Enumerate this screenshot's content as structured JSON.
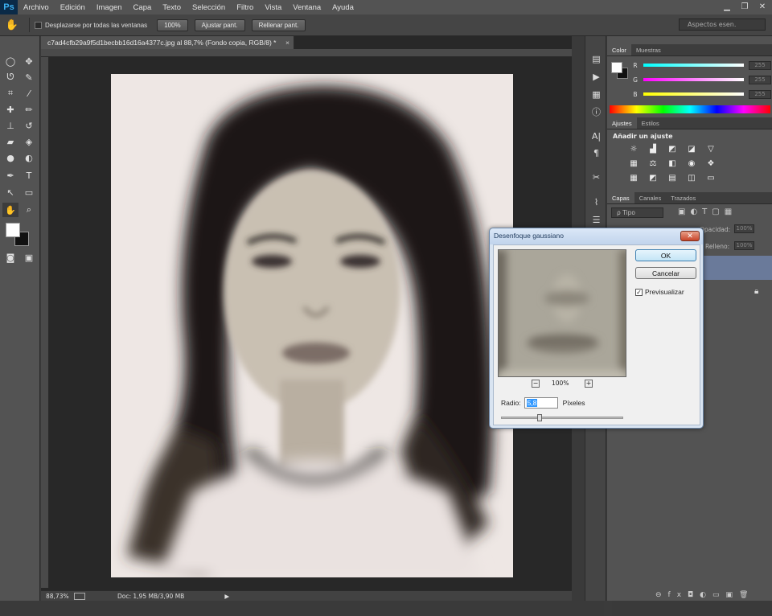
{
  "app": {
    "logo": "Ps"
  },
  "menu": [
    "Archivo",
    "Edición",
    "Imagen",
    "Capa",
    "Texto",
    "Selección",
    "Filtro",
    "Vista",
    "Ventana",
    "Ayuda"
  ],
  "options": {
    "scroll_all_label": "Desplazarse por todas las ventanas",
    "buttons": [
      "100%",
      "Ajustar pant.",
      "Rellenar pant."
    ],
    "workspace_placeholder": "Aspectos esen."
  },
  "document": {
    "tab_title": "c7ad4cfb29a9f5d1becbb16d16a4377c.jpg al 88,7% (Fondo copia, RGB/8) *",
    "tab_close": "×"
  },
  "status": {
    "zoom": "88,73%",
    "doc": "Doc: 1,95 MB/3,90 MB"
  },
  "color_panel": {
    "tabs": [
      "Color",
      "Muestras"
    ],
    "channels": [
      {
        "label": "R",
        "value": "255",
        "color": "#e84a4a"
      },
      {
        "label": "G",
        "value": "255",
        "color": "#3bd13b"
      },
      {
        "label": "B",
        "value": "255",
        "color": "#4a6be8"
      }
    ]
  },
  "adjustments_panel": {
    "tabs": [
      "Ajustes",
      "Estilos"
    ],
    "title": "Añadir un ajuste"
  },
  "layers_panel": {
    "tabs": [
      "Capas",
      "Canales",
      "Trazados"
    ],
    "filter_label": "ρ Tipo",
    "opacity_label": "Opacidad:",
    "fill_label": "Relleno:",
    "opacity_value": "100%",
    "fill_value": "100%"
  },
  "dialog": {
    "title": "Desenfoque gaussiano",
    "close": "✕",
    "ok": "OK",
    "cancel": "Cancelar",
    "preview_label": "Previsualizar",
    "preview_checked": "✓",
    "zoom": "100%",
    "zoom_minus": "−",
    "zoom_plus": "+",
    "radius_label": "Radio:",
    "radius_value": "5,8",
    "radius_unit": "Píxeles",
    "slider_fraction": 0.3
  }
}
